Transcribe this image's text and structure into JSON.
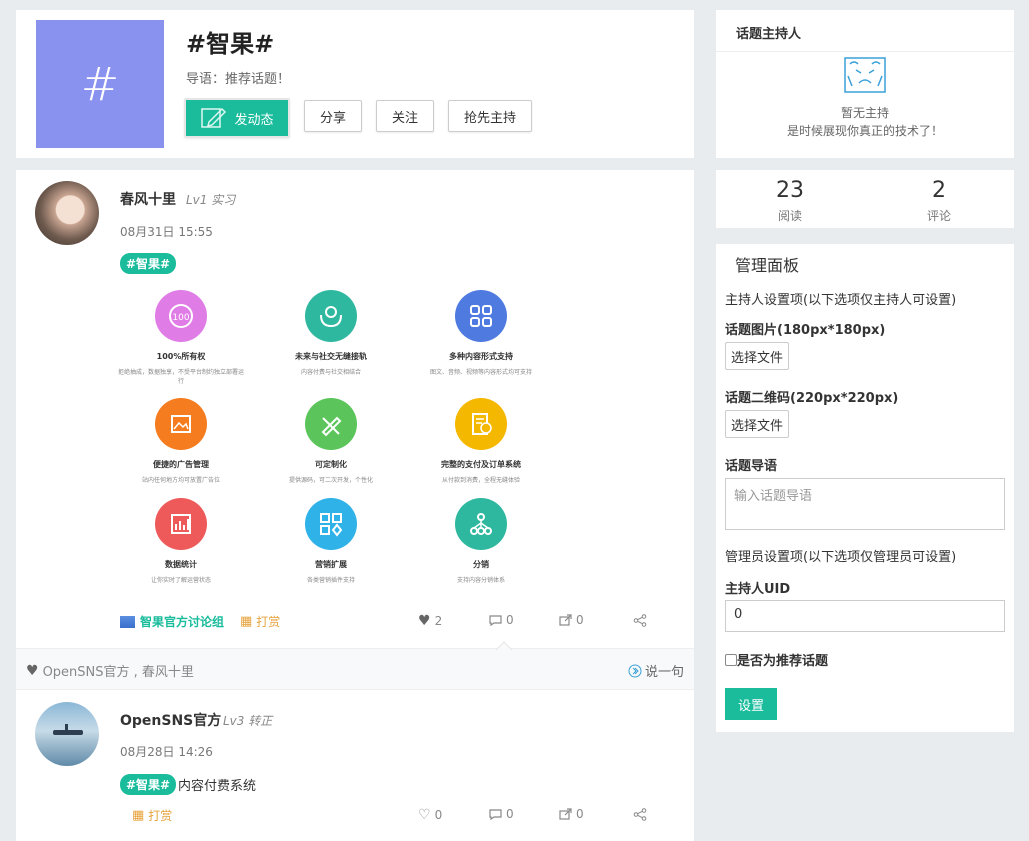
{
  "topic": {
    "logo_symbol": "#",
    "title": "#智果#",
    "intro": "导语：推荐话题！",
    "buttons": {
      "post": "发动态",
      "share": "分享",
      "follow": "关注",
      "host": "抢先主持"
    }
  },
  "host": {
    "title": "话题主持人",
    "empty_line1": "暂无主持",
    "empty_line2": "是时候展现你真正的技术了！"
  },
  "stats": {
    "reads": "23",
    "reads_label": "阅读",
    "comments": "2",
    "comments_label": "评论"
  },
  "admin": {
    "title": "管理面板",
    "host_section": "主持人设置项(以下选项仅主持人可设置)",
    "image_label": "话题图片(180px*180px)",
    "qr_label": "话题二维码(220px*220px)",
    "choose_file": "选择文件",
    "intro_label": "话题导语",
    "intro_placeholder": "输入话题导语",
    "admin_section": "管理员设置项(以下选项仅管理员可设置)",
    "uid_label": "主持人UID",
    "uid_value": "0",
    "recommend_label": "是否为推荐话题",
    "save": "设置"
  },
  "feed": {
    "post1": {
      "user": "春风十里",
      "level": "Lv1 实习",
      "time": "08月31日 15:55",
      "tag": "#智果#",
      "features": [
        {
          "title": "100%所有权",
          "desc": "拒绝抽成，数据独享，不受平台制约独立部署运行",
          "color": "#e07ce6",
          "icon": "badge-icon"
        },
        {
          "title": "未来与社交无缝接轨",
          "desc": "内容付费与社交相结合",
          "color": "#2fb8a0",
          "icon": "hands-icon"
        },
        {
          "title": "多种内容形式支持",
          "desc": "图文、音频、视频等内容形式均可支持",
          "color": "#4f7be0",
          "icon": "grid-icon"
        },
        {
          "title": "便捷的广告管理",
          "desc": "站内任何地方均可放置广告位",
          "color": "#f57c1f",
          "icon": "image-icon"
        },
        {
          "title": "可定制化",
          "desc": "提供源码，可二次开发，个性化",
          "color": "#5bc55b",
          "icon": "pencil-ruler-icon"
        },
        {
          "title": "完整的支付及订单系统",
          "desc": "从付款到消费，全程无缝体验",
          "color": "#f5b800",
          "icon": "receipt-icon"
        },
        {
          "title": "数据统计",
          "desc": "让你实时了解运营状态",
          "color": "#ee5a5a",
          "icon": "bar-chart-icon"
        },
        {
          "title": "营销扩展",
          "desc": "各类营销插件支持",
          "color": "#2eb2e8",
          "icon": "apps-icon"
        },
        {
          "title": "分销",
          "desc": "支持内容分销体系",
          "color": "#2fb8a0",
          "icon": "network-icon"
        }
      ],
      "group": "智果官方讨论组",
      "reward": "打赏",
      "likes": "2",
      "comments": "0",
      "shares": "0"
    },
    "likers": "OpenSNS官方 , 春风十里",
    "say": "说一句",
    "post2": {
      "user": "OpenSNS官方",
      "level": "Lv3 转正",
      "time": "08月28日 14:26",
      "tag": "#智果#",
      "text": "内容付费系统",
      "reward": "打赏",
      "likes": "0",
      "comments": "0",
      "shares": "0"
    }
  }
}
